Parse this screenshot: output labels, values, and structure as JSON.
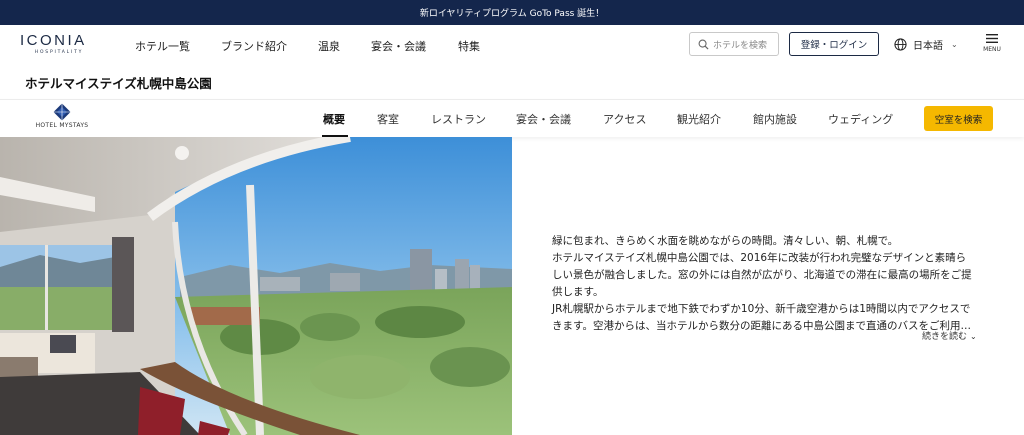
{
  "promo": {
    "text": "新ロイヤリティプログラム GoTo Pass 誕生！"
  },
  "header": {
    "logo_main": "ICONIA",
    "logo_sub": "HOSPITALITY",
    "nav": [
      "ホテル一覧",
      "ブランド紹介",
      "温泉",
      "宴会・会議",
      "特集"
    ],
    "search_placeholder": "ホテルを検索",
    "login_label": "登録・ログイン",
    "language": "日本語",
    "menu_label": "MENU"
  },
  "hotel": {
    "title": "ホテルマイステイズ札幌中島公園"
  },
  "subnav": {
    "brand": "HOTEL MYSTAYS",
    "tabs": [
      "概要",
      "客室",
      "レストラン",
      "宴会・会議",
      "アクセス",
      "観光紹介",
      "館内施設",
      "ウェディング"
    ],
    "active_tab": "概要",
    "cta": "空室を検索"
  },
  "description": {
    "lines": [
      "緑に包まれ、きらめく水面を眺めながらの時間。清々しい、朝、札幌で。",
      "ホテルマイステイズ札幌中島公園では、2016年に改装が行われ完璧なデザインと素晴ら",
      "しい景色が融合しました。窓の外には自然が広がり、北海道での滞在に最高の場所をご提",
      "供します。",
      "JR札幌駅からホテルまで地下鉄でわずか10分、新千歳空港からは1時間以内でアクセスで",
      "きます。空港からは、当ホテルから数分の距離にある中島公園まで直通のバスをご利用…"
    ],
    "read_more": "続きを読む"
  },
  "colors": {
    "promo_bg": "#14264c",
    "brand_navy": "#1c2a44",
    "cta_yellow": "#f5b800"
  }
}
